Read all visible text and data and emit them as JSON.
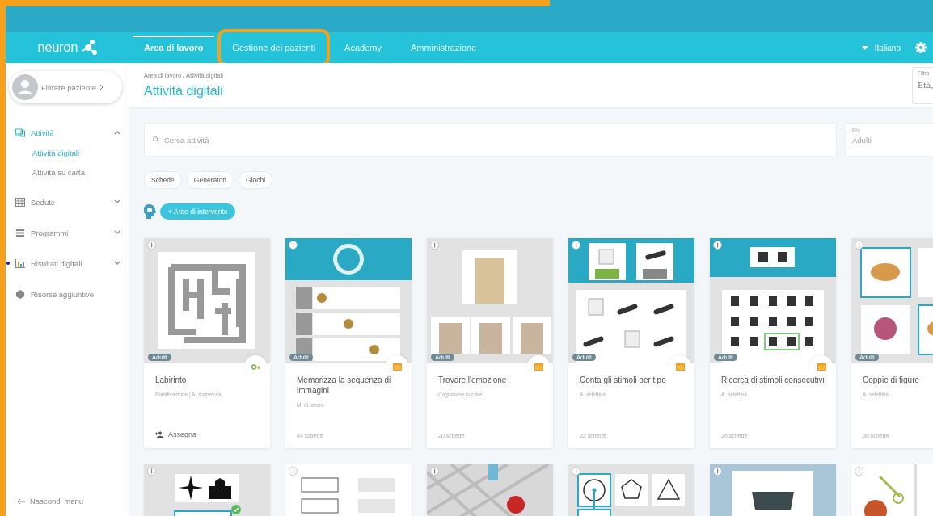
{
  "logo": {
    "text": "neuron"
  },
  "nav": {
    "tabs": [
      {
        "label": "Area di lavoro",
        "selected": true,
        "highlighted": false
      },
      {
        "label": "Gestione dei pazienti",
        "selected": false,
        "highlighted": true
      },
      {
        "label": "Academy",
        "selected": false,
        "highlighted": false
      },
      {
        "label": "Amministrazione",
        "selected": false,
        "highlighted": false
      }
    ],
    "language": "Italiano"
  },
  "sidebar": {
    "patient_filter": "Filtrare paziente",
    "items": [
      {
        "label": "Attività",
        "selected": true,
        "expanded": true,
        "notification": false,
        "children": [
          {
            "label": "Attività digitali",
            "selected": true
          },
          {
            "label": "Attività su carta",
            "selected": false
          }
        ]
      },
      {
        "label": "Sedute",
        "selected": false,
        "expanded": false,
        "notification": false
      },
      {
        "label": "Programmi",
        "selected": false,
        "expanded": false,
        "notification": false
      },
      {
        "label": "Risultati digitali",
        "selected": false,
        "expanded": false,
        "notification": true
      },
      {
        "label": "Risorse aggiuntive",
        "selected": false,
        "notification": false
      }
    ],
    "hide_menu": "Nascondi menu"
  },
  "header": {
    "breadcrumb": "Area di lavoro / Attività digitali",
    "title": "Attività digitali",
    "filter": {
      "label": "Filtro",
      "value": "Età,"
    }
  },
  "search": {
    "placeholder": "Cerca attività"
  },
  "age_select": {
    "label": "Età",
    "value": "Adulti"
  },
  "chips": [
    {
      "label": "Schede"
    },
    {
      "label": "Generatori"
    },
    {
      "label": "Giochi"
    }
  ],
  "areas_button": "+ Aree di intervento",
  "cards": [
    {
      "age": "Adulti",
      "title": "Labirinto",
      "subtitle": "Pianificazione | A. sostenuta",
      "action": "Assegna"
    },
    {
      "age": "Adulti",
      "title": "Memorizza la sequenza di immagini",
      "subtitle": "M. di lavoro",
      "count": "44 schede"
    },
    {
      "age": "Adulti",
      "title": "Trovare l'emozione",
      "subtitle": "Cognizione sociale",
      "count": "20 schede"
    },
    {
      "age": "Adulti",
      "title": "Conta gli stimoli per tipo",
      "subtitle": "A. selettiva",
      "count": "32 schede"
    },
    {
      "age": "Adulti",
      "title": "Ricerca di stimoli consecutivi",
      "subtitle": "A. selettiva",
      "count": "36 schede"
    },
    {
      "age": "Adulti",
      "title": "Coppie di figure",
      "subtitle": "A. selettiva",
      "count": "30 schede"
    }
  ],
  "more_cards": [
    {
      "checked": true
    },
    {
      "checked": false
    },
    {
      "checked": false
    },
    {
      "checked": false
    },
    {
      "checked": false
    },
    {
      "checked": false
    }
  ]
}
